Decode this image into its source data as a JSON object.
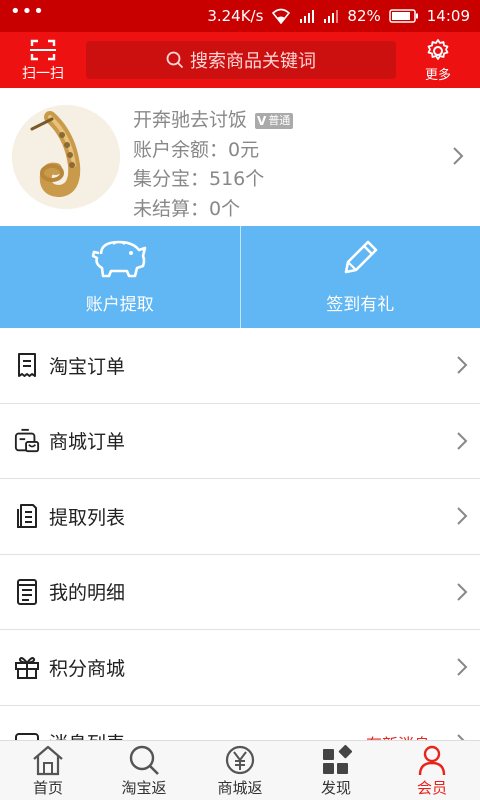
{
  "status_bar": {
    "dots": "•••",
    "speed": "3.24K/s",
    "battery": "82%",
    "time": "14:09"
  },
  "topbar": {
    "scan_label": "扫一扫",
    "search_placeholder": "搜索商品关键词",
    "more_label": "更多"
  },
  "profile": {
    "name": "开奔驰去讨饭",
    "badge": "普通",
    "balance": "账户余额：0元",
    "points": "集分宝：516个",
    "unsettled": "未结算：0个"
  },
  "actions": [
    {
      "label": "账户提取",
      "icon": "piggy-bank-icon"
    },
    {
      "label": "签到有礼",
      "icon": "pencil-icon"
    }
  ],
  "menu": [
    {
      "label": "淘宝订单",
      "icon": "receipt-icon"
    },
    {
      "label": "商城订单",
      "icon": "shop-order-icon"
    },
    {
      "label": "提取列表",
      "icon": "document-list-icon"
    },
    {
      "label": "我的明细",
      "icon": "ledger-icon"
    },
    {
      "label": "积分商城",
      "icon": "gift-icon"
    },
    {
      "label": "消息列表",
      "icon": "message-icon",
      "extra": "有新消息"
    }
  ],
  "tabs": [
    {
      "label": "首页",
      "icon": "home-icon"
    },
    {
      "label": "淘宝返",
      "icon": "search-icon"
    },
    {
      "label": "商城返",
      "icon": "yen-coin-icon"
    },
    {
      "label": "发现",
      "icon": "discover-grid-icon"
    },
    {
      "label": "会员",
      "icon": "member-icon",
      "active": true
    }
  ],
  "colors": {
    "brand_red": "#ee1111",
    "action_blue": "#61b7f4",
    "active_red": "#e8231b"
  }
}
